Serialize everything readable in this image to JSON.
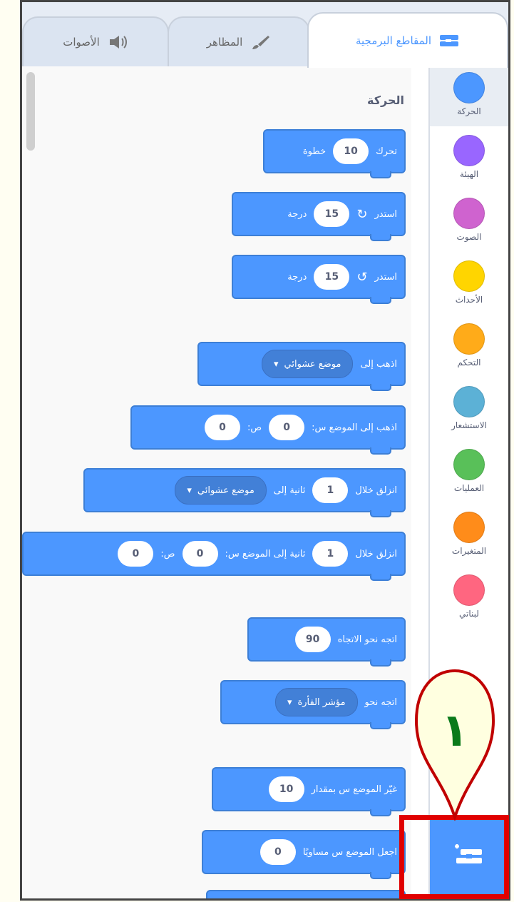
{
  "tabs": [
    {
      "label": "المقاطع البرمجية",
      "icon": "code-icon",
      "active": true
    },
    {
      "label": "المظاهر",
      "icon": "brush-icon",
      "active": false
    },
    {
      "label": "الأصوات",
      "icon": "speaker-icon",
      "active": false
    }
  ],
  "categories": [
    {
      "label": "الحركة",
      "color": "#4c97ff",
      "active": true
    },
    {
      "label": "الهيئة",
      "color": "#9966ff"
    },
    {
      "label": "الصوت",
      "color": "#cf63cf"
    },
    {
      "label": "الأحداث",
      "color": "#ffd500"
    },
    {
      "label": "التحكم",
      "color": "#ffab19"
    },
    {
      "label": "الاستشعار",
      "color": "#5cb1d6"
    },
    {
      "label": "العمليات",
      "color": "#59c059"
    },
    {
      "label": "المتغيرات",
      "color": "#ff8c1a"
    },
    {
      "label": "لبناتي",
      "color": "#ff6680"
    }
  ],
  "section_title": "الحركة",
  "blocks": {
    "move": {
      "text1": "تحرك",
      "value": "10",
      "text2": "خطوة"
    },
    "turn_right": {
      "text1": "استدر",
      "value": "15",
      "text2": "درجة"
    },
    "turn_left": {
      "text1": "استدر",
      "value": "15",
      "text2": "درجة"
    },
    "goto": {
      "text1": "اذهب إلى",
      "dropdown": "موضع عشوائي"
    },
    "goto_xy": {
      "text1": "اذهب إلى الموضع س:",
      "x": "0",
      "text2": "ص:",
      "y": "0"
    },
    "glide_to": {
      "text1": "انزلق خلال",
      "secs": "1",
      "text2": "ثانية إلى",
      "dropdown": "موضع عشوائي"
    },
    "glide_xy": {
      "text1": "انزلق خلال",
      "secs": "1",
      "text2": "ثانية إلى الموضع س:",
      "x": "0",
      "text3": "ص:",
      "y": "0"
    },
    "point_dir": {
      "text1": "اتجه نحو الاتجاه",
      "value": "90"
    },
    "point_towards": {
      "text1": "اتجه نحو",
      "dropdown": "مؤشر الفأرة"
    },
    "change_x": {
      "text1": "غيّر الموضع س بمقدار",
      "value": "10"
    },
    "set_x": {
      "text1": "اجعل الموضع س مساويًا",
      "value": "0"
    }
  },
  "callout_label": "١",
  "extension_button_icon": "add-extension-icon",
  "colors": {
    "motion": "#4c97ff",
    "highlight": "#e00000",
    "callout_stroke": "#c00000"
  }
}
